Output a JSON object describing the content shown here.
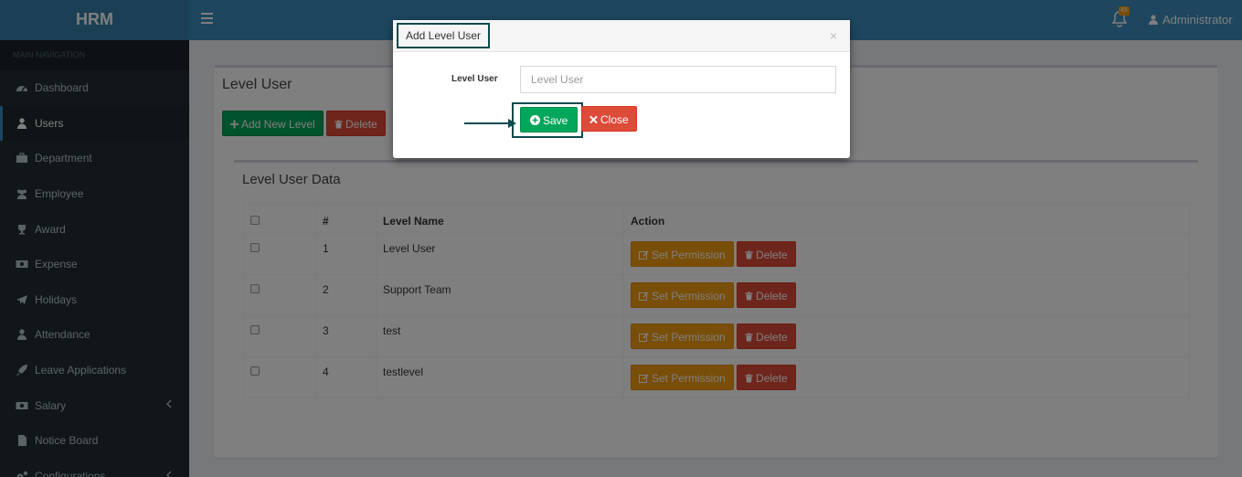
{
  "app": {
    "logo": "HRM"
  },
  "header": {
    "notification_count": "45",
    "user_name": "Administrator"
  },
  "sidebar": {
    "heading": "MAIN NAVIGATION",
    "items": [
      {
        "label": "Dashboard",
        "icon": "dashboard-icon"
      },
      {
        "label": "Users",
        "icon": "user-icon",
        "active": true
      },
      {
        "label": "Department",
        "icon": "briefcase-icon"
      },
      {
        "label": "Employee",
        "icon": "users-icon"
      },
      {
        "label": "Award",
        "icon": "trophy-icon"
      },
      {
        "label": "Expense",
        "icon": "money-icon"
      },
      {
        "label": "Holidays",
        "icon": "paper-plane-icon"
      },
      {
        "label": "Attendance",
        "icon": "user-icon"
      },
      {
        "label": "Leave Applications",
        "icon": "rocket-icon"
      },
      {
        "label": "Salary",
        "icon": "money-icon",
        "has_submenu": true
      },
      {
        "label": "Notice Board",
        "icon": "file-icon"
      },
      {
        "label": "Configurations",
        "icon": "gears-icon",
        "has_submenu": true
      }
    ]
  },
  "main": {
    "title": "Level User",
    "add_button": "Add New Level",
    "delete_button": "Delete",
    "table_title": "Level User Data",
    "columns": [
      "",
      "#",
      "Level Name",
      "Action"
    ],
    "rows": [
      {
        "num": "1",
        "name": "Level User"
      },
      {
        "num": "2",
        "name": "Support Team"
      },
      {
        "num": "3",
        "name": "test"
      },
      {
        "num": "4",
        "name": "testlevel"
      }
    ],
    "row_actions": {
      "permission": "Set Permission",
      "delete": "Delete"
    }
  },
  "modal": {
    "title": "Add Level User",
    "close_symbol": "×",
    "field_label": "Level User",
    "field_placeholder": "Level User",
    "field_value": "",
    "save_button": "Save",
    "close_button": "Close"
  },
  "colors": {
    "header": "#3c8dbc",
    "sidebar": "#222d32",
    "green": "#00a65a",
    "red": "#dd4b39",
    "orange": "#f39c12",
    "highlight": "#0e4a4e"
  }
}
